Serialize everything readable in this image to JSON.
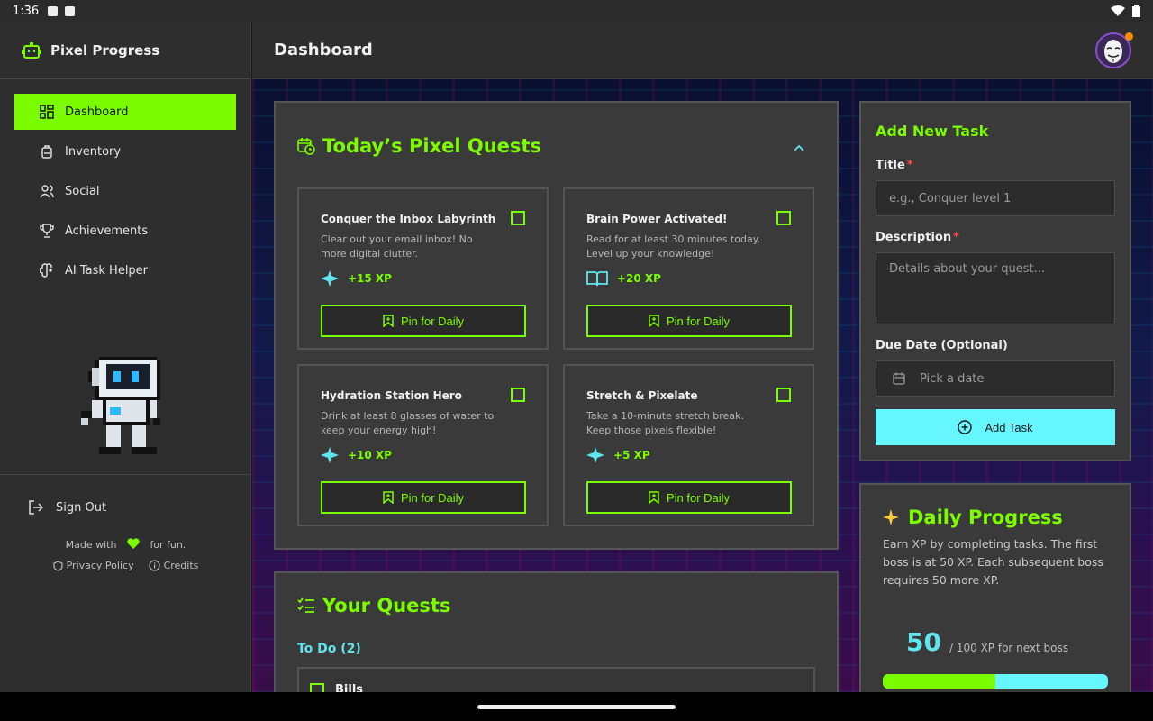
{
  "status_bar": {
    "time": "1:36"
  },
  "app": {
    "name": "Pixel Progress"
  },
  "header": {
    "title": "Dashboard"
  },
  "sidebar": {
    "items": [
      {
        "label": "Dashboard",
        "icon": "dashboard-grid-icon",
        "active": true
      },
      {
        "label": "Inventory",
        "icon": "backpack-icon"
      },
      {
        "label": "Social",
        "icon": "users-icon"
      },
      {
        "label": "Achievements",
        "icon": "trophy-icon"
      },
      {
        "label": "AI Task Helper",
        "icon": "brain-icon"
      }
    ],
    "sign_out": "Sign Out",
    "made_with_prefix": "Made with",
    "made_with_suffix": "for fun.",
    "privacy": "Privacy Policy",
    "credits": "Credits"
  },
  "today": {
    "title": "Today’s Pixel Quests",
    "quests": [
      {
        "title": "Conquer the Inbox Labyrinth",
        "desc": "Clear out your email inbox! No more digital clutter.",
        "xp": "+15 XP",
        "icon": "sparkle-icon",
        "pin": "Pin for Daily"
      },
      {
        "title": "Brain Power Activated!",
        "desc": "Read for at least 30 minutes today. Level up your knowledge!",
        "xp": "+20 XP",
        "icon": "book-icon",
        "pin": "Pin for Daily"
      },
      {
        "title": "Hydration Station Hero",
        "desc": "Drink at least 8 glasses of water to keep your energy high!",
        "xp": "+10 XP",
        "icon": "sparkle-icon",
        "pin": "Pin for Daily"
      },
      {
        "title": "Stretch & Pixelate",
        "desc": "Take a 10-minute stretch break. Keep those pixels flexible!",
        "xp": "+5 XP",
        "icon": "sparkle-icon",
        "pin": "Pin for Daily"
      }
    ]
  },
  "your_quests": {
    "title": "Your Quests",
    "todo_label": "To Do (2)",
    "first_item": "Bills"
  },
  "add_task": {
    "title": "Add New Task",
    "title_label": "Title",
    "title_placeholder": "e.g., Conquer level 1",
    "desc_label": "Description",
    "desc_placeholder": "Details about your quest...",
    "due_label": "Due Date (Optional)",
    "due_placeholder": "Pick a date",
    "button": "Add Task",
    "required_mark": "*"
  },
  "daily_progress": {
    "title": "Daily Progress",
    "desc": "Earn XP by completing tasks. The first boss is at 50 XP. Each subsequent boss requires 50 more XP.",
    "xp_current": "50",
    "xp_next_text": "/ 100 XP for next boss",
    "progress_fraction": 0.5
  },
  "colors": {
    "accent_green": "#7cfc00",
    "accent_cyan": "#66f6ff",
    "required_red": "#ff4d4d"
  }
}
